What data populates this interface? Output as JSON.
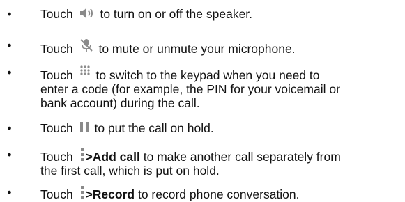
{
  "bullet": "•",
  "items": [
    {
      "pre": "Touch",
      "icon": "speaker-icon",
      "post": "to turn on or off the speaker."
    },
    {
      "pre": "Touch",
      "icon": "microphone-mute-icon",
      "post": "to mute or unmute your microphone."
    },
    {
      "pre": "Touch",
      "icon": "keypad-icon",
      "post_lines": [
        "to switch to the keypad when you need to",
        "enter a code (for example, the PIN for your voicemail or",
        "bank account) during the call."
      ]
    },
    {
      "pre": "Touch",
      "icon": "pause-icon",
      "post": "to put the call on hold."
    },
    {
      "pre": "Touch",
      "icon": "more-options-icon",
      "bold": ">Add call",
      "post_lines": [
        "to make another call separately from",
        "the first call, which is put on hold."
      ]
    },
    {
      "pre": "Touch",
      "icon": "more-options-icon",
      "bold": ">Record",
      "post": "to record phone conversation."
    }
  ],
  "colors": {
    "text": "#111111",
    "icon": "#8a8a8a"
  }
}
